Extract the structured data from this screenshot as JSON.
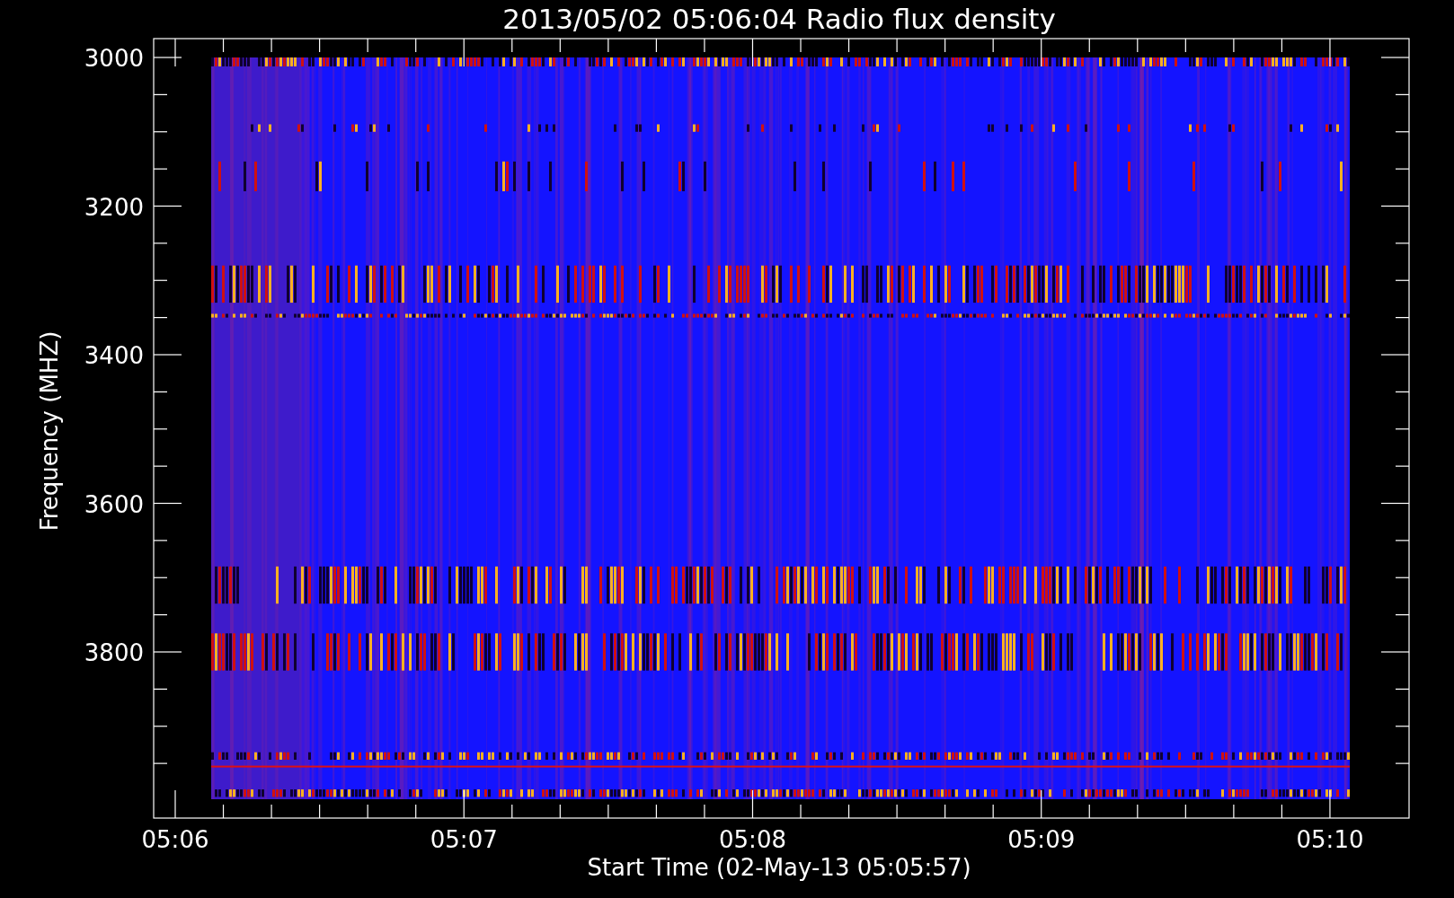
{
  "title": "2013/05/02 05:06:04 Radio flux density",
  "y_axis": {
    "label": "Frequency (MHZ)",
    "tick_labels": [
      "3000",
      "3200",
      "3400",
      "3600",
      "3800"
    ]
  },
  "x_axis": {
    "label": "Start Time (02-May-13 05:05:57)",
    "tick_labels": [
      "05:06",
      "05:07",
      "05:08",
      "05:09",
      "05:10"
    ]
  }
}
